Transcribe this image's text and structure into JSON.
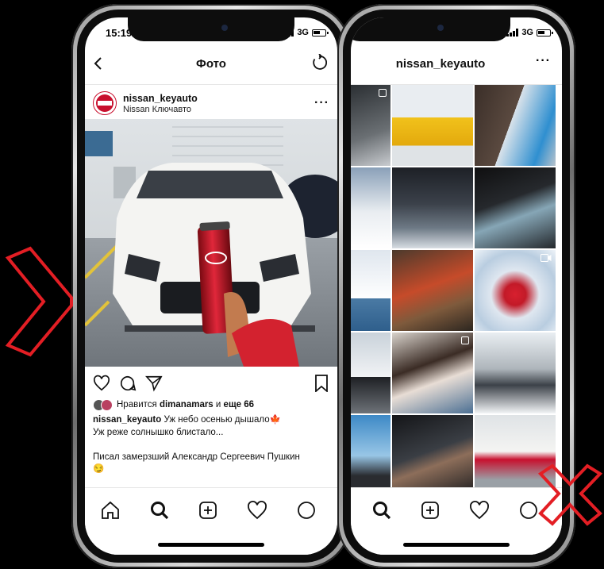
{
  "left_phone": {
    "status": {
      "time": "15:19",
      "network": "3G"
    },
    "nav": {
      "title": "Фото"
    },
    "post": {
      "username": "nissan_keyauto",
      "location": "Nissan Ключавто",
      "likes_prefix": "Нравится ",
      "liked_by": "dimanamars",
      "likes_joiner": " и ",
      "likes_more": "еще 66",
      "caption_user": "nissan_keyauto",
      "caption_text": " Уж небо осенью дышало🍁\nУж реже солнышко блистало...\n\nПисал замерзший  Александр Сергеевич Пушкин\n😏"
    },
    "tabs": [
      "home-icon",
      "search-icon",
      "add-icon",
      "heart-icon",
      "profile-icon"
    ]
  },
  "right_phone": {
    "status": {
      "network": "3G"
    },
    "nav": {
      "title": "nissan_keyauto"
    },
    "tabs": [
      "search-icon",
      "add-icon",
      "heart-icon",
      "profile-icon"
    ]
  },
  "colors": {
    "brand_red": "#c8102e",
    "accent": "#e31e24"
  }
}
